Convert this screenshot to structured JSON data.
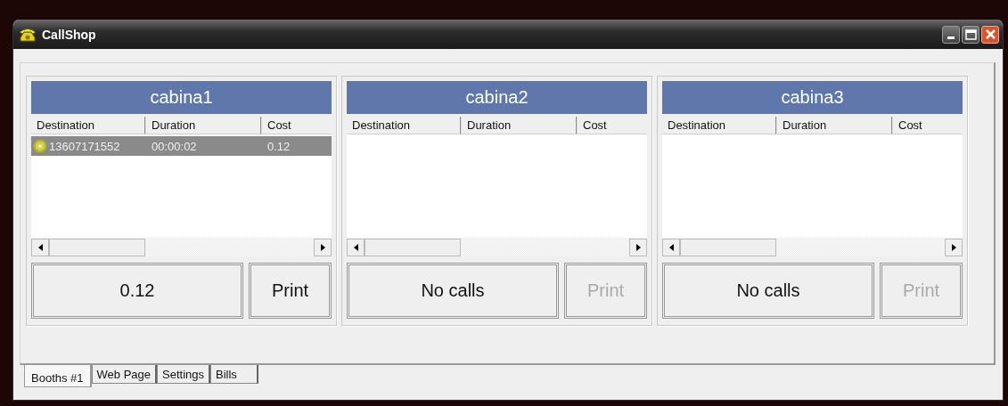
{
  "window": {
    "title": "CallShop"
  },
  "booths": [
    {
      "name": "cabina1",
      "columns": [
        "Destination",
        "Duration",
        "Cost"
      ],
      "rows": [
        {
          "destination": "13607171552",
          "duration": "00:00:02",
          "cost": "0.12",
          "selected": true
        }
      ],
      "total": "0.12",
      "print": {
        "label": "Print",
        "disabled": false
      }
    },
    {
      "name": "cabina2",
      "columns": [
        "Destination",
        "Duration",
        "Cost"
      ],
      "total": "No calls",
      "print": {
        "label": "Print",
        "disabled": true
      }
    },
    {
      "name": "cabina3",
      "columns": [
        "Destination",
        "Duration",
        "Cost"
      ],
      "total": "No calls",
      "print": {
        "label": "Print",
        "disabled": true
      }
    }
  ],
  "tabs": [
    {
      "label": "Booths #1",
      "selected": true
    },
    {
      "label": "Web Page",
      "selected": false
    },
    {
      "label": "Settings",
      "selected": false
    },
    {
      "label": "Bills",
      "selected": false
    }
  ]
}
